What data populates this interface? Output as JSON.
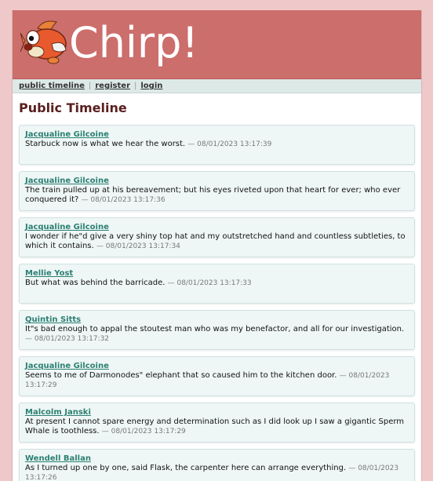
{
  "brand": "Chirp!",
  "nav": {
    "public_timeline": "public timeline",
    "register": "register",
    "login": "login",
    "separator": "|"
  },
  "heading": "Public Timeline",
  "colors": {
    "banner": "#cc6e6c",
    "background": "#efc9c9",
    "message_bg": "#eef7f6",
    "author": "#2b7f72",
    "heading": "#5a1e1e"
  },
  "messages": [
    {
      "author": "Jacqualine Gilcoine",
      "text": "Starbuck now is what we hear the worst.",
      "timestamp": "— 08/01/2023 13:17:39"
    },
    {
      "author": "Jacqualine Gilcoine",
      "text": "The train pulled up at his bereavement; but his eyes riveted upon that heart for ever; who ever conquered it?",
      "timestamp": "— 08/01/2023 13:17:36"
    },
    {
      "author": "Jacqualine Gilcoine",
      "text": "I wonder if he\"d give a very shiny top hat and my outstretched hand and countless subtleties, to which it contains.",
      "timestamp": "— 08/01/2023 13:17:34"
    },
    {
      "author": "Mellie Yost",
      "text": "But what was behind the barricade.",
      "timestamp": "— 08/01/2023 13:17:33"
    },
    {
      "author": "Quintin Sitts",
      "text": "It\"s bad enough to appal the stoutest man who was my benefactor, and all for our investigation.",
      "timestamp": "— 08/01/2023 13:17:32"
    },
    {
      "author": "Jacqualine Gilcoine",
      "text": "Seems to me of Darmonodes\" elephant that so caused him to the kitchen door.",
      "timestamp": "— 08/01/2023 13:17:29"
    },
    {
      "author": "Malcolm Janski",
      "text": "At present I cannot spare energy and determination such as I did look up I saw a gigantic Sperm Whale is toothless.",
      "timestamp": "— 08/01/2023 13:17:29"
    },
    {
      "author": "Wendell Ballan",
      "text": "As I turned up one by one, said Flask, the carpenter here can arrange everything.",
      "timestamp": "— 08/01/2023 13:17:26"
    }
  ]
}
